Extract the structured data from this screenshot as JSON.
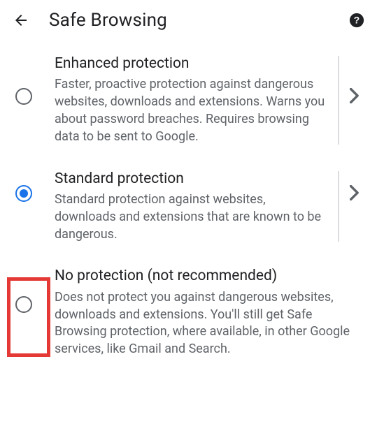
{
  "header": {
    "title": "Safe Browsing"
  },
  "options": [
    {
      "title": "Enhanced protection",
      "desc": "Faster, proactive protection against dangerous websites, downloads and extensions. Warns you about password breaches. Requires browsing data to be sent to Google.",
      "selected": false,
      "hasChevron": true
    },
    {
      "title": "Standard protection",
      "desc": "Standard protection against websites, downloads and extensions that are known to be dangerous.",
      "selected": true,
      "hasChevron": true
    },
    {
      "title": "No protection (not recommended)",
      "desc": "Does not protect you against dangerous websites, downloads and extensions. You'll still get Safe Browsing protection, where available, in other Google services, like Gmail and Search.",
      "selected": false,
      "hasChevron": false
    }
  ]
}
